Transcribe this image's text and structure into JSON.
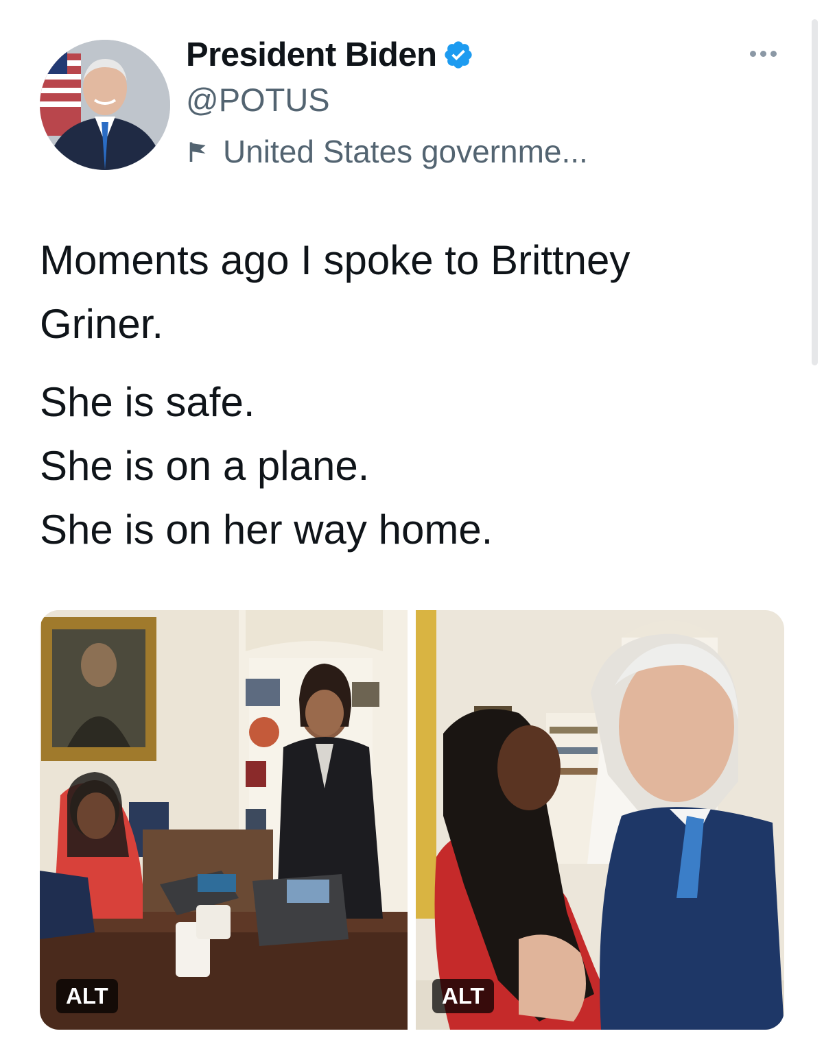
{
  "tweet": {
    "author": {
      "display_name": "President Biden",
      "handle": "@POTUS",
      "affiliation": "United States governme...",
      "verified_icon": "verified-badge-icon",
      "affiliation_icon": "flag-icon"
    },
    "more_icon": "more-options-icon",
    "text_lines_1": [
      "Moments ago I spoke to Brittney",
      "Griner."
    ],
    "text_lines_2": [
      "She is safe.",
      "She is on a plane.",
      "She is on her way home."
    ],
    "media": [
      {
        "alt_label": "ALT"
      },
      {
        "alt_label": "ALT"
      }
    ],
    "colors": {
      "verified": "#1d9bf0",
      "secondary_text": "#536471"
    }
  }
}
